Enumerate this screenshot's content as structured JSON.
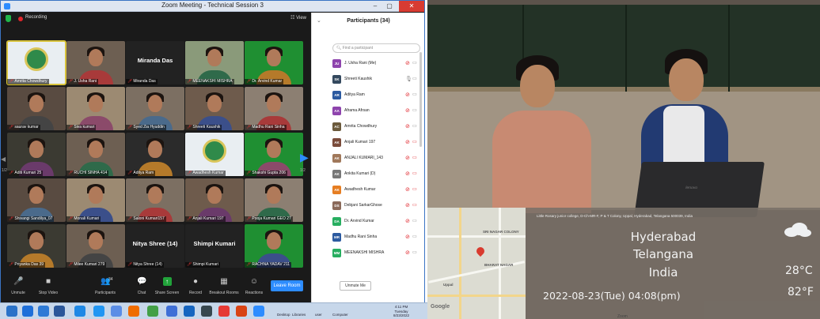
{
  "window": {
    "title": "Zoom Meeting - Technical Session 3",
    "min": "–",
    "max": "▢",
    "close": "✕"
  },
  "meeting": {
    "recording_label": "Recording",
    "view_label": "☷ View"
  },
  "gallery": {
    "page_left": "1/2",
    "page_right": "1/2",
    "tiles": [
      {
        "name": "Amrita Chowdhury",
        "type": "logo"
      },
      {
        "name": "J. Usha Rani",
        "type": "video"
      },
      {
        "name": "Miranda Das",
        "type": "name",
        "label": "Miranda Das"
      },
      {
        "name": "MEENAKSHI MISHRA",
        "type": "video"
      },
      {
        "name": "Dr. Arvind Kumar",
        "type": "video"
      },
      {
        "name": "saurav kumar",
        "type": "video"
      },
      {
        "name": "Siva kumari",
        "type": "video"
      },
      {
        "name": "Syed Zia Hyuddin",
        "type": "video"
      },
      {
        "name": "Shreeti Kaushik",
        "type": "video"
      },
      {
        "name": "Madhu Rani Sinha",
        "type": "video"
      },
      {
        "name": "Aditi Kumari 25",
        "type": "video"
      },
      {
        "name": "RUCHI SINHA 414",
        "type": "video"
      },
      {
        "name": "Aditya Ram",
        "type": "video"
      },
      {
        "name": "Awadhesh Kumar",
        "type": "logo"
      },
      {
        "name": "Shakshi Gupta 206",
        "type": "video"
      },
      {
        "name": "Shivangi Sandilya_07",
        "type": "video"
      },
      {
        "name": "Monali Kumari",
        "type": "video"
      },
      {
        "name": "Saloni Kumari157",
        "type": "video"
      },
      {
        "name": "Anjali Kumari 197",
        "type": "video"
      },
      {
        "name": "Pooja Kumari GEO 27",
        "type": "video"
      },
      {
        "name": "Priyanka Das 39",
        "type": "video"
      },
      {
        "name": "Milee Kumari 279",
        "type": "video"
      },
      {
        "name": "Nitya Shree (14)",
        "type": "name",
        "label": "Nitya Shree (14)"
      },
      {
        "name": "Shimpi Kumari",
        "type": "name",
        "label": "Shimpi Kumari"
      },
      {
        "name": "RACHNA YADAV 211",
        "type": "video"
      }
    ]
  },
  "toolbar": {
    "unmute": "Unmute",
    "stop_video": "Stop Video",
    "participants": "Participants",
    "participants_count": "34",
    "chat": "Chat",
    "share_screen": "Share Screen",
    "record": "Record",
    "breakout_rooms": "Breakout Rooms",
    "reactions": "Reactions",
    "leave": "Leave Room"
  },
  "participants_panel": {
    "title": "Participants (34)",
    "search_placeholder": "Find a participant",
    "unmute_me": "Unmute Me",
    "items": [
      {
        "initials": "JU",
        "name": "J. Usha Rani (Me)",
        "color": "#8e44ad",
        "mic_on": false,
        "video_off": false
      },
      {
        "initials": "SK",
        "name": "Shreeti Kaushik",
        "color": "#34495e",
        "mic_on": true,
        "video_off": false
      },
      {
        "initials": "AR",
        "name": "Aditya Ram",
        "color": "#2c5aa0",
        "mic_on": false,
        "video_off": false
      },
      {
        "initials": "AA",
        "name": "Aframa Afrsan",
        "color": "#8e44ad",
        "mic_on": false,
        "video_off": false
      },
      {
        "initials": "AC",
        "name": "Amrita Chowdhury",
        "color": "#6b5a3c",
        "mic_on": false,
        "video_off": false
      },
      {
        "initials": "AK",
        "name": "Anjali Kumari 197",
        "color": "#7a4b3a",
        "mic_on": false,
        "video_off": true
      },
      {
        "initials": "AK",
        "name": "ANJALI KUMARI_143",
        "color": "#a0785a",
        "mic_on": false,
        "video_off": true
      },
      {
        "initials": "AK",
        "name": "Ankita Kumari (D)",
        "color": "#777777",
        "mic_on": false,
        "video_off": true
      },
      {
        "initials": "AK",
        "name": "Awadhesh Kumar",
        "color": "#e67e22",
        "mic_on": false,
        "video_off": true
      },
      {
        "initials": "DS",
        "name": "Debjani SarkarGhose",
        "color": "#8a6a5a",
        "mic_on": false,
        "video_off": true
      },
      {
        "initials": "DA",
        "name": "Dr. Arvind Kumar",
        "color": "#27ae60",
        "mic_on": false,
        "video_off": false
      },
      {
        "initials": "MR",
        "name": "Madhu Rani Sinha",
        "color": "#2c5aa0",
        "mic_on": false,
        "video_off": false
      },
      {
        "initials": "MM",
        "name": "MEENAKSHI MISHRA",
        "color": "#27ae60",
        "mic_on": false,
        "video_off": false
      }
    ]
  },
  "video_overlay": {
    "address": "Little Rosary junior college, D-Ch-MR-F, P & T Colony, Uppal, Hyderabad, Telangana 500039, India",
    "city": "Hyderabad",
    "state": "Telangana",
    "country": "India",
    "datetime": "2022-08-23(Tue)  04:08(pm)",
    "temp_c": "28°C",
    "temp_f": "82°F",
    "map_label_1": "SRI NAGAR COLONY",
    "map_label_2": "BHARAT NAGAR",
    "map_label_3": "Uppal",
    "map_brand": "Google",
    "laptop_brand": "lenovo"
  },
  "taskbar": {
    "items": [
      {
        "label": "",
        "color": "#2a72c8"
      },
      {
        "label": "",
        "color": "#1e6fd9"
      },
      {
        "label": "",
        "color": "#2d7ad6"
      },
      {
        "label": "",
        "color": "#2b579a"
      },
      {
        "label": "",
        "color": "#1e88e5"
      },
      {
        "label": "",
        "color": "#2196f3"
      },
      {
        "label": "",
        "color": "#5b8ee6"
      },
      {
        "label": "",
        "color": "#ef6c00"
      },
      {
        "label": "",
        "color": "#43a047"
      },
      {
        "label": "",
        "color": "#3f6fd6"
      },
      {
        "label": "",
        "color": "#1565c0"
      },
      {
        "label": "",
        "color": "#37474f"
      },
      {
        "label": "",
        "color": "#e53935"
      },
      {
        "label": "",
        "color": "#d84315"
      },
      {
        "label": "",
        "color": "#2d8cff"
      }
    ],
    "desktop": "Desktop",
    "libraries": "Libraries",
    "user": "user",
    "computer": "Computer",
    "time": "4:11 PM",
    "day": "Tuesday",
    "date": "8/23/2022"
  },
  "zoom_ctrl": "Zoom"
}
